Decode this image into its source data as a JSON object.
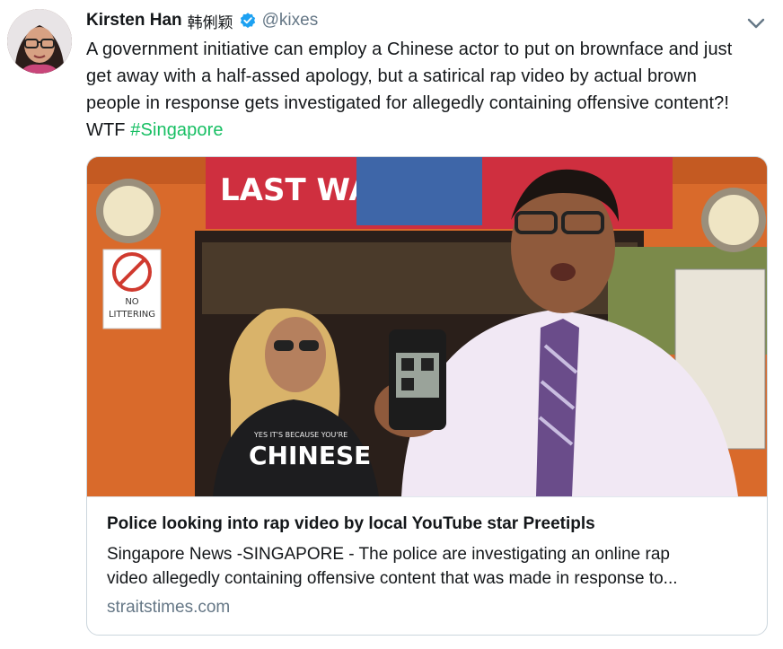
{
  "tweet": {
    "author_name": "Kirsten Han",
    "author_name_cjk": "韩俐颖",
    "verified": true,
    "handle": "@kixes",
    "text_lines": [
      "A government initiative can employ a Chinese actor to put on brownface and just",
      "get away with a half-assed apology, but a satirical rap video by actual brown",
      "people in response gets investigated for allegedly containing offensive content?!",
      "WTF "
    ],
    "hashtag": "#Singapore",
    "icons": {
      "verified": "verified-badge-icon",
      "menu": "chevron-down-icon"
    }
  },
  "card": {
    "image_text": {
      "banner": "LAST WAY",
      "sign_line1": "NO",
      "sign_line2": "LITTERING",
      "shirt_small": "YES IT'S BECAUSE YOU'RE",
      "shirt_big": "CHINESE"
    },
    "title": "Police looking into rap video by local YouTube star Preetipls",
    "description_lines": [
      "Singapore News -SINGAPORE - The police are investigating an online rap",
      "video allegedly containing offensive content that was made in response to..."
    ],
    "domain": "straitstimes.com"
  },
  "colors": {
    "text": "#14171a",
    "secondary": "#657786",
    "hashtag": "#17bf63",
    "verified": "#1da1f2",
    "border": "#ccd6dd"
  }
}
